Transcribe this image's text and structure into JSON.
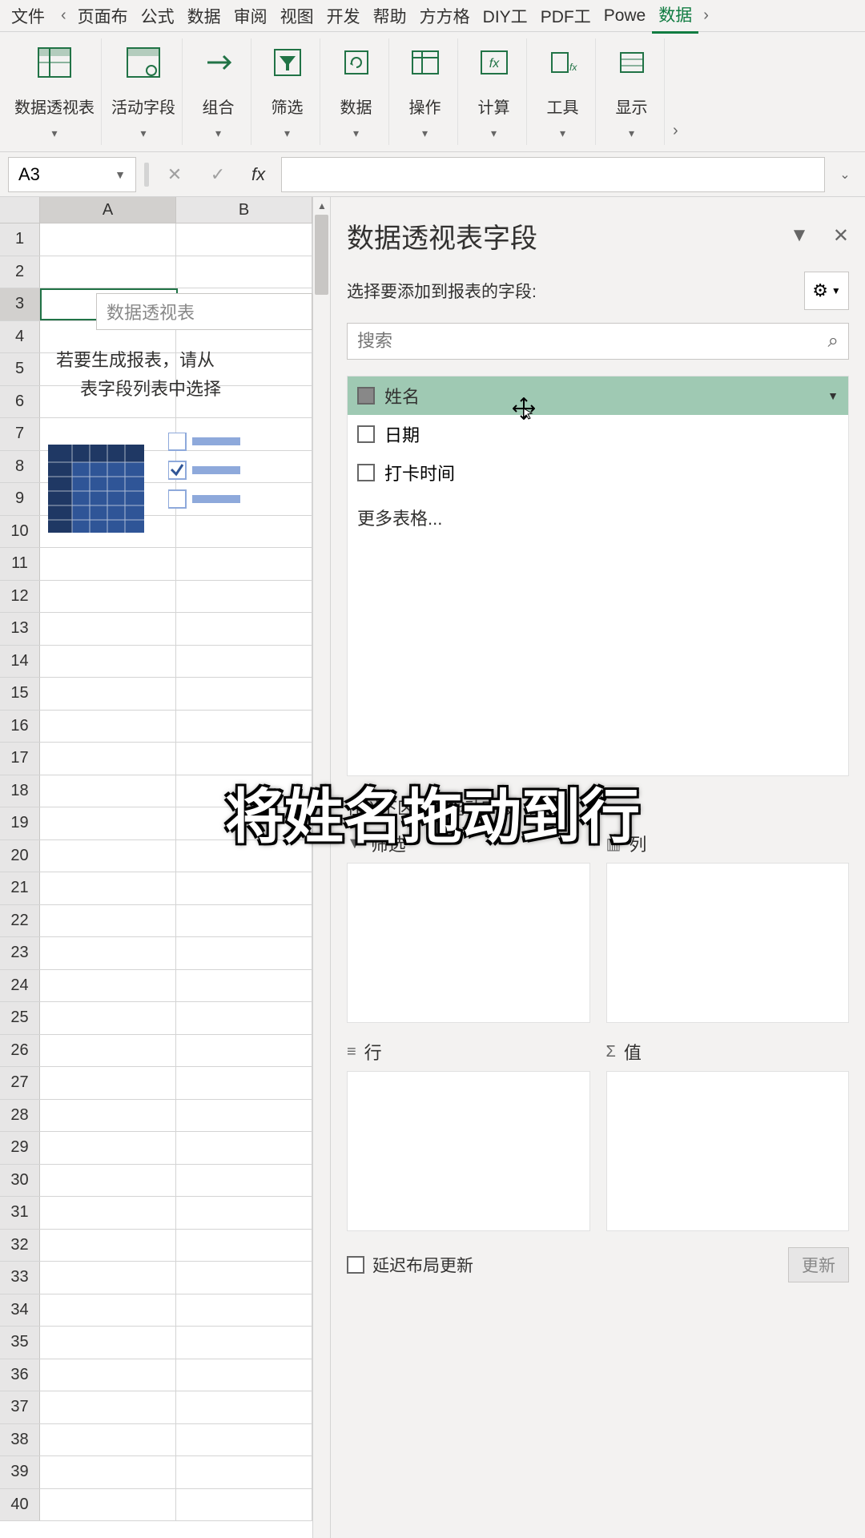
{
  "tabs": {
    "file": "文件",
    "items": [
      "页面布",
      "公式",
      "数据",
      "审阅",
      "视图",
      "开发",
      "帮助",
      "方方格",
      "DIY工",
      "PDF工",
      "Powe"
    ],
    "active": "数据"
  },
  "ribbon": [
    {
      "label": "数据透视表"
    },
    {
      "label": "活动字段"
    },
    {
      "label": "组合"
    },
    {
      "label": "筛选"
    },
    {
      "label": "数据"
    },
    {
      "label": "操作"
    },
    {
      "label": "计算"
    },
    {
      "label": "工具"
    },
    {
      "label": "显示"
    }
  ],
  "namebox": "A3",
  "fx": "fx",
  "columns": [
    "A",
    "B"
  ],
  "selected_row": 3,
  "placeholder": {
    "title": "数据透视表",
    "line1": "若要生成报表，请从",
    "line2": "表字段列表中选择"
  },
  "pane": {
    "title": "数据透视表字段",
    "sub": "选择要添加到报表的字段:",
    "search_placeholder": "搜索",
    "fields": [
      {
        "label": "姓名",
        "highlighted": true
      },
      {
        "label": "日期",
        "highlighted": false
      },
      {
        "label": "打卡时间",
        "highlighted": false
      }
    ],
    "more": "更多表格...",
    "areas_label": "在以下区域间拖动字段:",
    "areas": {
      "filter": "筛选",
      "columns": "列",
      "rows": "行",
      "values": "值"
    },
    "defer": "延迟布局更新",
    "update": "更新"
  },
  "caption": "将姓名拖动到行"
}
